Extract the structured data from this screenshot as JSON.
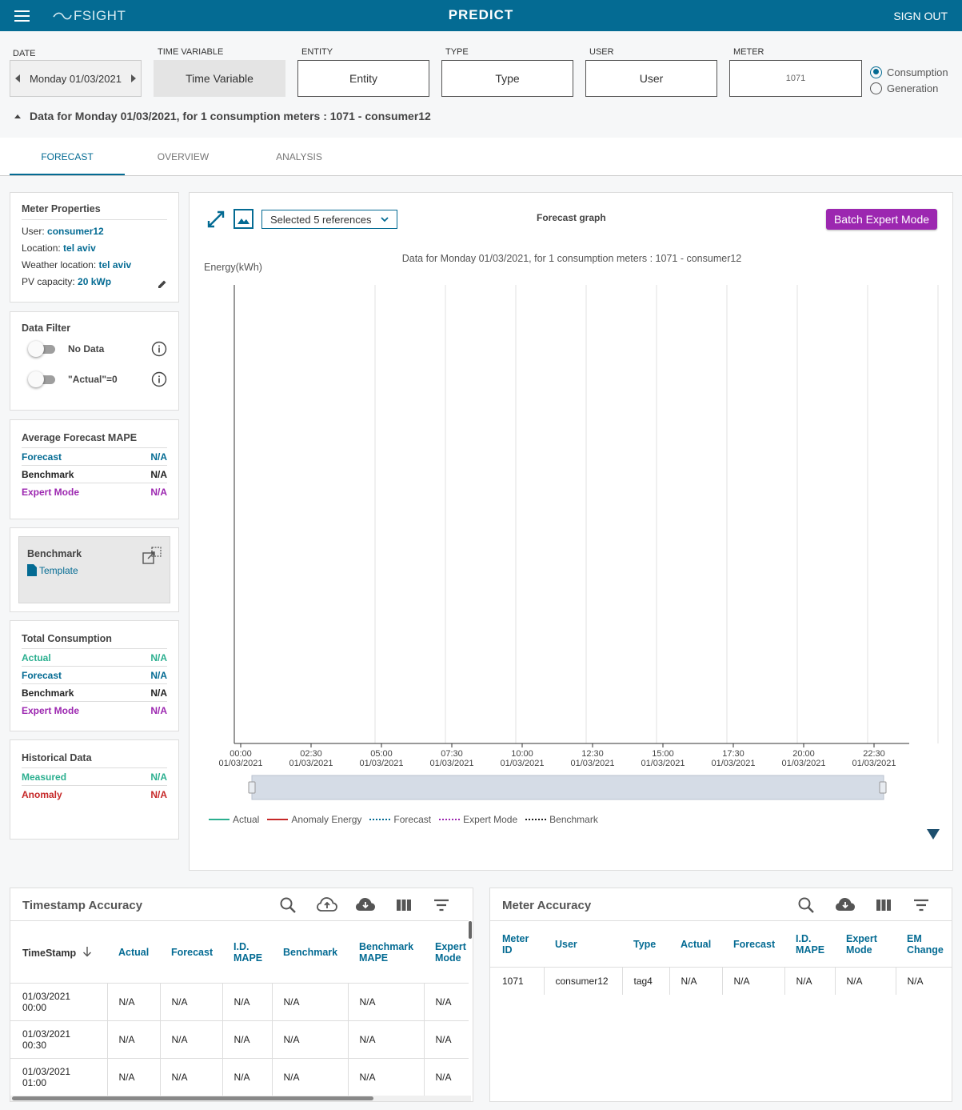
{
  "app": {
    "title": "PREDICT",
    "logo_text": "FSIGHT",
    "sign_out": "SIGN OUT"
  },
  "filters": {
    "date_label": "DATE",
    "date_value": "Monday 01/03/2021",
    "time_variable_label": "TIME VARIABLE",
    "time_variable_value": "Time Variable",
    "entity_label": "ENTITY",
    "entity_value": "Entity",
    "type_label": "TYPE",
    "type_value": "Type",
    "user_label": "USER",
    "user_value": "User",
    "meter_label": "METER",
    "meter_value": "1071",
    "mode_options": [
      "Consumption",
      "Generation"
    ],
    "mode_selected": "Consumption"
  },
  "summary": "Data for Monday 01/03/2021, for 1 consumption meters : 1071 - consumer12",
  "tabs": [
    "FORECAST",
    "OVERVIEW",
    "ANALYSIS"
  ],
  "active_tab": "FORECAST",
  "meter_properties": {
    "title": "Meter Properties",
    "user_label": "User:",
    "user": "consumer12",
    "location_label": "Location:",
    "location": "tel aviv",
    "weather_label": "Weather location:",
    "weather_location": "tel aviv",
    "pv_label": "PV capacity:",
    "pv_capacity": "20 kWp"
  },
  "data_filter": {
    "title": "Data Filter",
    "no_data": "No Data",
    "actual_zero": "\"Actual\"=0"
  },
  "average_mape": {
    "title": "Average Forecast MAPE",
    "rows": [
      {
        "label": "Forecast",
        "value": "N/A"
      },
      {
        "label": "Benchmark",
        "value": "N/A"
      },
      {
        "label": "Expert Mode",
        "value": "N/A"
      }
    ]
  },
  "benchmark": {
    "title": "Benchmark",
    "template": "Template"
  },
  "total_consumption": {
    "title": "Total Consumption",
    "rows": [
      {
        "label": "Actual",
        "value": "N/A"
      },
      {
        "label": "Forecast",
        "value": "N/A"
      },
      {
        "label": "Benchmark",
        "value": "N/A"
      },
      {
        "label": "Expert Mode",
        "value": "N/A"
      }
    ]
  },
  "historical": {
    "title": "Historical Data",
    "rows": [
      {
        "label": "Measured",
        "value": "N/A"
      },
      {
        "label": "Anomaly",
        "value": "N/A"
      }
    ]
  },
  "colors": {
    "primary": "#046b93",
    "expert": "#9c27b0",
    "actual": "#2baf8f",
    "anomaly": "#c62828",
    "benchmark": "#222222"
  },
  "chart_panel": {
    "references_select": "Selected 5 references",
    "graph_title": "Forecast graph",
    "batch_button": "Batch Expert Mode"
  },
  "chart_data": {
    "type": "line",
    "title": "Data for Monday 01/03/2021, for 1  consumption meters : 1071 - consumer12",
    "ylabel": "Energy(kWh)",
    "xlabel": "",
    "x_ticks": [
      [
        "00:00",
        "01/03/2021"
      ],
      [
        "02:30",
        "01/03/2021"
      ],
      [
        "05:00",
        "01/03/2021"
      ],
      [
        "07:30",
        "01/03/2021"
      ],
      [
        "10:00",
        "01/03/2021"
      ],
      [
        "12:30",
        "01/03/2021"
      ],
      [
        "15:00",
        "01/03/2021"
      ],
      [
        "17:30",
        "01/03/2021"
      ],
      [
        "20:00",
        "01/03/2021"
      ],
      [
        "22:30",
        "01/03/2021"
      ]
    ],
    "series": [
      {
        "name": "Actual",
        "values": [],
        "style": "solid",
        "color": "#2baf8f"
      },
      {
        "name": "Anomaly Energy",
        "values": [],
        "style": "solid",
        "color": "#c62828"
      },
      {
        "name": "Forecast",
        "values": [],
        "style": "dotted",
        "color": "#046b93"
      },
      {
        "name": "Expert Mode",
        "values": [],
        "style": "dotted",
        "color": "#9c27b0"
      },
      {
        "name": "Benchmark",
        "values": [],
        "style": "dotted",
        "color": "#222222"
      }
    ],
    "grid": "vertical",
    "legend_position": "bottom-left"
  },
  "timestamp_accuracy": {
    "title": "Timestamp Accuracy",
    "columns": [
      [
        "TimeStamp",
        ""
      ],
      [
        "Actual",
        ""
      ],
      [
        "Forecast",
        ""
      ],
      [
        "I.D.",
        "MAPE"
      ],
      [
        "Benchmark",
        ""
      ],
      [
        "Benchmark",
        "MAPE"
      ],
      [
        "Expert",
        "Mode"
      ]
    ],
    "rows": [
      [
        [
          "01/03/2021",
          "00:00"
        ],
        "N/A",
        "N/A",
        "N/A",
        "N/A",
        "N/A",
        "N/A"
      ],
      [
        [
          "01/03/2021",
          "00:30"
        ],
        "N/A",
        "N/A",
        "N/A",
        "N/A",
        "N/A",
        "N/A"
      ],
      [
        [
          "01/03/2021",
          "01:00"
        ],
        "N/A",
        "N/A",
        "N/A",
        "N/A",
        "N/A",
        "N/A"
      ]
    ]
  },
  "meter_accuracy": {
    "title": "Meter Accuracy",
    "columns": [
      [
        "Meter",
        "ID"
      ],
      [
        "User",
        ""
      ],
      [
        "Type",
        ""
      ],
      [
        "Actual",
        ""
      ],
      [
        "Forecast",
        ""
      ],
      [
        "I.D.",
        "MAPE"
      ],
      [
        "Expert",
        "Mode"
      ],
      [
        "EM",
        "Change"
      ]
    ],
    "rows": [
      [
        "1071",
        "consumer12",
        "tag4",
        "N/A",
        "N/A",
        "N/A",
        "N/A",
        "N/A"
      ]
    ]
  }
}
